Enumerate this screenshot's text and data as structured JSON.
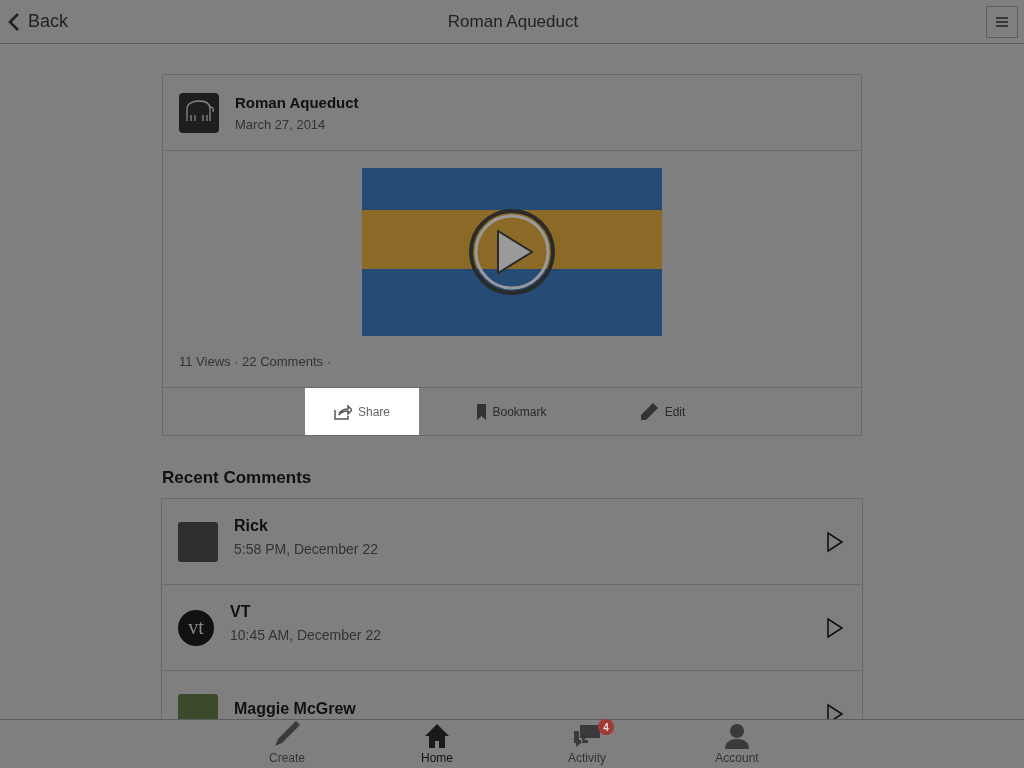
{
  "top_bar": {
    "back": "Back",
    "title": "Roman Aqueduct"
  },
  "post": {
    "title": "Roman Aqueduct",
    "date": "March 27, 2014",
    "stats": "11 Views · 22 Comments ·",
    "actions": [
      {
        "kind": "share",
        "label": "Share",
        "selected": true
      },
      {
        "kind": "bookmark",
        "label": "Bookmark",
        "selected": false
      },
      {
        "kind": "edit",
        "label": "Edit",
        "selected": false
      }
    ]
  },
  "comments_heading": "Recent Comments",
  "comments": [
    {
      "kind": "photo",
      "name": "Rick",
      "time": "5:58 PM, December 22"
    },
    {
      "kind": "logo",
      "logo_text": "vt",
      "name": "VT",
      "time": "10:45 AM, December 22"
    },
    {
      "kind": "flower",
      "name": "Maggie McGrew"
    }
  ],
  "tab_bar": [
    {
      "kind": "create",
      "label": "Create",
      "selected": false
    },
    {
      "kind": "home",
      "label": "Home",
      "selected": true
    },
    {
      "kind": "activity",
      "label": "Activity",
      "selected": false,
      "badge": "4"
    },
    {
      "kind": "account",
      "label": "Account",
      "selected": false
    }
  ]
}
